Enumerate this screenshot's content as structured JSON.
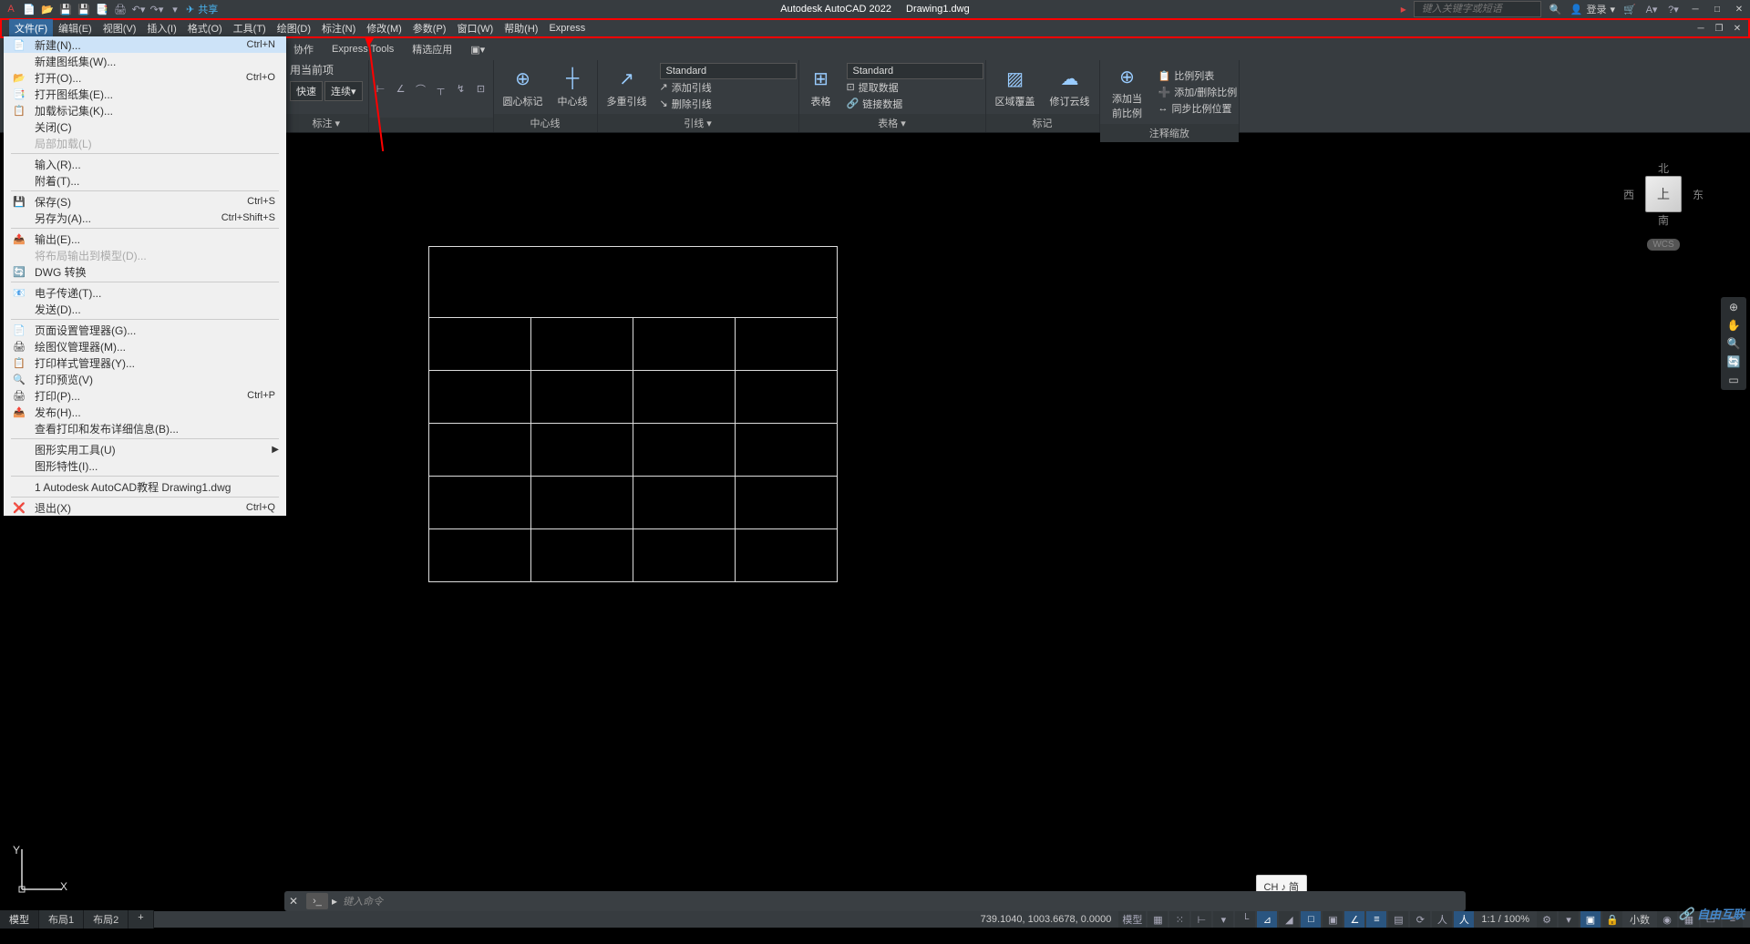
{
  "titlebar": {
    "share": "共享",
    "app_title": "Autodesk AutoCAD 2022",
    "doc_name": "Drawing1.dwg",
    "search_placeholder": "键入关键字或短语",
    "login": "登录"
  },
  "menubar": {
    "items": [
      "文件(F)",
      "编辑(E)",
      "视图(V)",
      "插入(I)",
      "格式(O)",
      "工具(T)",
      "绘图(D)",
      "标注(N)",
      "修改(M)",
      "参数(P)",
      "窗口(W)",
      "帮助(H)",
      "Express"
    ]
  },
  "tabs": [
    "协作",
    "Express Tools",
    "精选应用"
  ],
  "file_menu": [
    {
      "icon": "📄",
      "label": "新建(N)...",
      "shortcut": "Ctrl+N",
      "highlighted": true
    },
    {
      "icon": "",
      "label": "新建图纸集(W)...",
      "shortcut": ""
    },
    {
      "icon": "📂",
      "label": "打开(O)...",
      "shortcut": "Ctrl+O"
    },
    {
      "icon": "📑",
      "label": "打开图纸集(E)...",
      "shortcut": ""
    },
    {
      "icon": "📋",
      "label": "加载标记集(K)...",
      "shortcut": ""
    },
    {
      "icon": "",
      "label": "关闭(C)",
      "shortcut": ""
    },
    {
      "icon": "",
      "label": "局部加载(L)",
      "shortcut": "",
      "disabled": true
    },
    {
      "sep": true
    },
    {
      "icon": "",
      "label": "输入(R)...",
      "shortcut": ""
    },
    {
      "icon": "",
      "label": "附着(T)...",
      "shortcut": ""
    },
    {
      "sep": true
    },
    {
      "icon": "💾",
      "label": "保存(S)",
      "shortcut": "Ctrl+S"
    },
    {
      "icon": "",
      "label": "另存为(A)...",
      "shortcut": "Ctrl+Shift+S"
    },
    {
      "sep": true
    },
    {
      "icon": "📤",
      "label": "输出(E)...",
      "shortcut": ""
    },
    {
      "icon": "",
      "label": "将布局输出到模型(D)...",
      "shortcut": "",
      "disabled": true
    },
    {
      "icon": "🔄",
      "label": "DWG 转换",
      "shortcut": ""
    },
    {
      "sep": true
    },
    {
      "icon": "📧",
      "label": "电子传递(T)...",
      "shortcut": ""
    },
    {
      "icon": "",
      "label": "发送(D)...",
      "shortcut": ""
    },
    {
      "sep": true
    },
    {
      "icon": "📄",
      "label": "页面设置管理器(G)...",
      "shortcut": ""
    },
    {
      "icon": "🖨",
      "label": "绘图仪管理器(M)...",
      "shortcut": ""
    },
    {
      "icon": "📋",
      "label": "打印样式管理器(Y)...",
      "shortcut": ""
    },
    {
      "icon": "🔍",
      "label": "打印预览(V)",
      "shortcut": ""
    },
    {
      "icon": "🖨",
      "label": "打印(P)...",
      "shortcut": "Ctrl+P"
    },
    {
      "icon": "📤",
      "label": "发布(H)...",
      "shortcut": ""
    },
    {
      "icon": "",
      "label": "查看打印和发布详细信息(B)...",
      "shortcut": ""
    },
    {
      "sep": true
    },
    {
      "icon": "",
      "label": "图形实用工具(U)",
      "shortcut": "",
      "submenu": true
    },
    {
      "icon": "",
      "label": "图形特性(I)...",
      "shortcut": ""
    },
    {
      "sep": true
    },
    {
      "icon": "",
      "label": "1 Autodesk AutoCAD教程 Drawing1.dwg",
      "shortcut": ""
    },
    {
      "sep": true
    },
    {
      "icon": "❌",
      "label": "退出(X)",
      "shortcut": "Ctrl+Q"
    }
  ],
  "ribbon": {
    "use_current": "用当前项",
    "quick": "快速",
    "cont": "连续",
    "dim_panel": "标注",
    "center_circle": "圆心标记",
    "center_line": "中心线",
    "center_panel": "中心线",
    "multileader": "多重引线",
    "add_leader": "添加引线",
    "remove_leader": "删除引线",
    "leader_panel": "引线",
    "std1": "Standard",
    "table": "表格",
    "std2": "Standard",
    "extract": "提取数据",
    "link": "链接数据",
    "table_panel": "表格",
    "wipeout": "区域覆盖",
    "revcloud": "修订云线",
    "mark_panel": "标记",
    "add_scale": "添加当前比例",
    "scale_list": "比例列表",
    "add_del_scale": "添加/删除比例",
    "sync_scale": "同步比例位置",
    "anno_panel": "注释缩放"
  },
  "viewcube": {
    "n": "北",
    "s": "南",
    "e": "东",
    "w": "西",
    "top": "上",
    "wcs": "WCS"
  },
  "cmd": {
    "placeholder": "键入命令"
  },
  "ime": "CH ♪ 简",
  "layout_tabs": [
    "模型",
    "布局1",
    "布局2"
  ],
  "status": {
    "coords": "739.1040, 1003.6678, 0.0000",
    "space": "模型",
    "scale": "1:1 / 100%",
    "units": "小数"
  },
  "watermark": "自由互联"
}
